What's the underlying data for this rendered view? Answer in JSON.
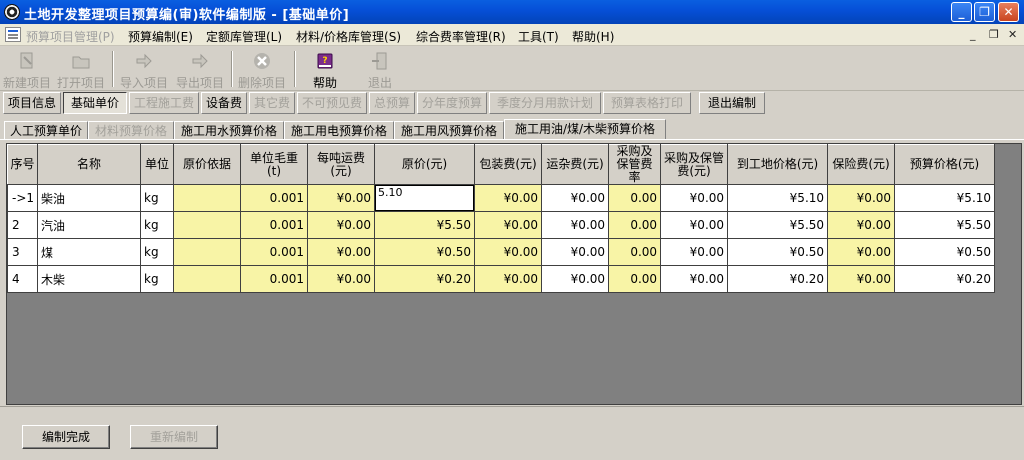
{
  "window": {
    "title": "土地开发整理项目预算编(审)软件编制版 - [基础单价]",
    "minimize": "_",
    "restore": "❐",
    "close": "✕"
  },
  "menu": [
    {
      "label": "预算项目管理(P)",
      "disabled": true
    },
    {
      "label": "预算编制(E)"
    },
    {
      "label": "定额库管理(L)"
    },
    {
      "label": "材料/价格库管理(S)"
    },
    {
      "label": "综合费率管理(R)"
    },
    {
      "label": "工具(T)"
    },
    {
      "label": "帮助(H)"
    }
  ],
  "mdi_controls": {
    "minimize": "_",
    "restore": "❐",
    "close": "✕"
  },
  "toolbar": [
    {
      "label": "新建项目",
      "icon": "new-project-icon",
      "disabled": true
    },
    {
      "label": "打开项目",
      "icon": "open-folder-icon",
      "disabled": true
    },
    {
      "label": "导入项目",
      "icon": "import-icon",
      "disabled": true
    },
    {
      "label": "导出项目",
      "icon": "export-icon",
      "disabled": true
    },
    {
      "label": "删除项目",
      "icon": "delete-icon",
      "disabled": true
    },
    {
      "label": "帮助",
      "icon": "help-book-icon",
      "disabled": false
    },
    {
      "label": "退出",
      "icon": "exit-icon",
      "disabled": true
    }
  ],
  "funcbar": [
    {
      "label": "项目信息"
    },
    {
      "label": "基础单价",
      "active": true
    },
    {
      "label": "工程施工费",
      "disabled": true
    },
    {
      "label": "设备费"
    },
    {
      "label": "其它费",
      "disabled": true
    },
    {
      "label": "不可预见费",
      "disabled": true
    },
    {
      "label": "总预算",
      "disabled": true
    },
    {
      "label": "分年度预算",
      "disabled": true
    },
    {
      "label": "季度分月用款计划",
      "disabled": true
    },
    {
      "label": "预算表格打印",
      "disabled": true
    },
    {
      "label": "退出编制"
    }
  ],
  "tabs": [
    {
      "label": "人工预算单价"
    },
    {
      "label": "材料预算价格",
      "disabled": true
    },
    {
      "label": "施工用水预算价格"
    },
    {
      "label": "施工用电预算价格"
    },
    {
      "label": "施工用风预算价格"
    },
    {
      "label": "施工用油/煤/木柴预算价格",
      "active": true
    }
  ],
  "grid": {
    "columns": [
      "序号",
      "名称",
      "单位",
      "原价依据",
      "单位毛重\n(t)",
      "每吨运费\n(元)",
      "原价(元)",
      "包装费(元)",
      "运杂费(元)",
      "采购及\n保管费\n率",
      "采购及保管\n费(元)",
      "到工地价格(元)",
      "保险费(元)",
      "预算价格(元)"
    ],
    "rows": [
      {
        "seq": "->1",
        "name": "柴油",
        "unit": "kg",
        "basis": "",
        "weight": "0.001",
        "freight": "¥0.00",
        "price": "5.10",
        "pack": "¥0.00",
        "misc": "¥0.00",
        "rate": "0.00",
        "purchase": "¥0.00",
        "site": "¥5.10",
        "insure": "¥0.00",
        "budget": "¥5.10",
        "editing": true
      },
      {
        "seq": "2",
        "name": "汽油",
        "unit": "kg",
        "basis": "",
        "weight": "0.001",
        "freight": "¥0.00",
        "price": "¥5.50",
        "pack": "¥0.00",
        "misc": "¥0.00",
        "rate": "0.00",
        "purchase": "¥0.00",
        "site": "¥5.50",
        "insure": "¥0.00",
        "budget": "¥5.50"
      },
      {
        "seq": "3",
        "name": "煤",
        "unit": "kg",
        "basis": "",
        "weight": "0.001",
        "freight": "¥0.00",
        "price": "¥0.50",
        "pack": "¥0.00",
        "misc": "¥0.00",
        "rate": "0.00",
        "purchase": "¥0.00",
        "site": "¥0.50",
        "insure": "¥0.00",
        "budget": "¥0.50"
      },
      {
        "seq": "4",
        "name": "木柴",
        "unit": "kg",
        "basis": "",
        "weight": "0.001",
        "freight": "¥0.00",
        "price": "¥0.20",
        "pack": "¥0.00",
        "misc": "¥0.00",
        "rate": "0.00",
        "purchase": "¥0.00",
        "site": "¥0.20",
        "insure": "¥0.00",
        "budget": "¥0.20"
      }
    ]
  },
  "bottom": [
    {
      "label": "编制完成"
    },
    {
      "label": "重新编制",
      "disabled": true
    }
  ],
  "colors": {
    "title_bar": "#0650d8",
    "yellow_cell": "#f8f4a6",
    "grid_bg": "#808080",
    "face": "#d4d0c8"
  }
}
